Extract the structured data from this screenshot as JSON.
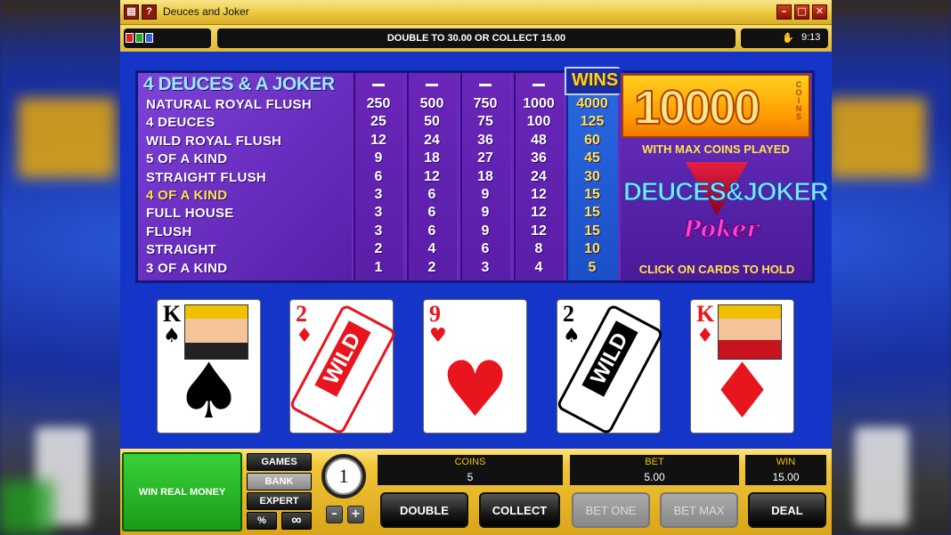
{
  "window": {
    "title": "Deuces and Joker"
  },
  "toolbar": {
    "message": "DOUBLE TO 30.00 OR COLLECT 15.00",
    "clock": "9:13"
  },
  "paytable": {
    "heading": "4 DEUCES & A JOKER",
    "wins_label": "WINS",
    "col_headers": [
      "–",
      "–",
      "–",
      "–"
    ],
    "rows": [
      {
        "name": "NATURAL ROYAL FLUSH",
        "values": [
          "250",
          "500",
          "750",
          "1000",
          "4000"
        ]
      },
      {
        "name": "4 DEUCES",
        "values": [
          "25",
          "50",
          "75",
          "100",
          "125"
        ]
      },
      {
        "name": "WILD ROYAL FLUSH",
        "values": [
          "12",
          "24",
          "36",
          "48",
          "60"
        ]
      },
      {
        "name": "5 OF A KIND",
        "values": [
          "9",
          "18",
          "27",
          "36",
          "45"
        ]
      },
      {
        "name": "STRAIGHT FLUSH",
        "values": [
          "6",
          "12",
          "18",
          "24",
          "30"
        ]
      },
      {
        "name": "4 OF A KIND",
        "values": [
          "3",
          "6",
          "9",
          "12",
          "15"
        ],
        "selected": true
      },
      {
        "name": "FULL HOUSE",
        "values": [
          "3",
          "6",
          "9",
          "12",
          "15"
        ]
      },
      {
        "name": "FLUSH",
        "values": [
          "3",
          "6",
          "9",
          "12",
          "15"
        ]
      },
      {
        "name": "STRAIGHT",
        "values": [
          "2",
          "4",
          "6",
          "8",
          "10"
        ]
      },
      {
        "name": "3 OF A KIND",
        "values": [
          "1",
          "2",
          "3",
          "4",
          "5"
        ]
      }
    ]
  },
  "promo": {
    "coins_amount": "10000",
    "coins_word": "COINS",
    "max_coins": "WITH MAX COINS PLAYED",
    "logo_main": "DEUCES&JOKER",
    "logo_sub": "Poker",
    "hold_hint": "CLICK ON CARDS TO HOLD"
  },
  "cards": [
    {
      "rank": "K",
      "suit": "♠",
      "color": "black",
      "type": "king"
    },
    {
      "rank": "2",
      "suit": "♦",
      "color": "red",
      "type": "wild",
      "wild_text": "WILD"
    },
    {
      "rank": "9",
      "suit": "♥",
      "color": "red",
      "type": "pip"
    },
    {
      "rank": "2",
      "suit": "♠",
      "color": "black",
      "type": "wild",
      "wild_text": "WILD"
    },
    {
      "rank": "K",
      "suit": "♦",
      "color": "red",
      "type": "king"
    }
  ],
  "bottom": {
    "win_real_money": "WIN REAL MONEY",
    "side_buttons": [
      "GAMES",
      "BANK",
      "EXPERT"
    ],
    "percent": "%",
    "infinity": "∞",
    "chip_value": "1",
    "minus": "–",
    "plus": "+",
    "coins_label": "COINS",
    "coins_value": "5",
    "bet_label": "BET",
    "bet_value": "5.00",
    "win_label": "WIN",
    "win_value": "15.00",
    "buttons": {
      "double": "DOUBLE",
      "collect": "COLLECT",
      "bet_one": "BET ONE",
      "bet_max": "BET MAX",
      "deal": "DEAL"
    }
  }
}
